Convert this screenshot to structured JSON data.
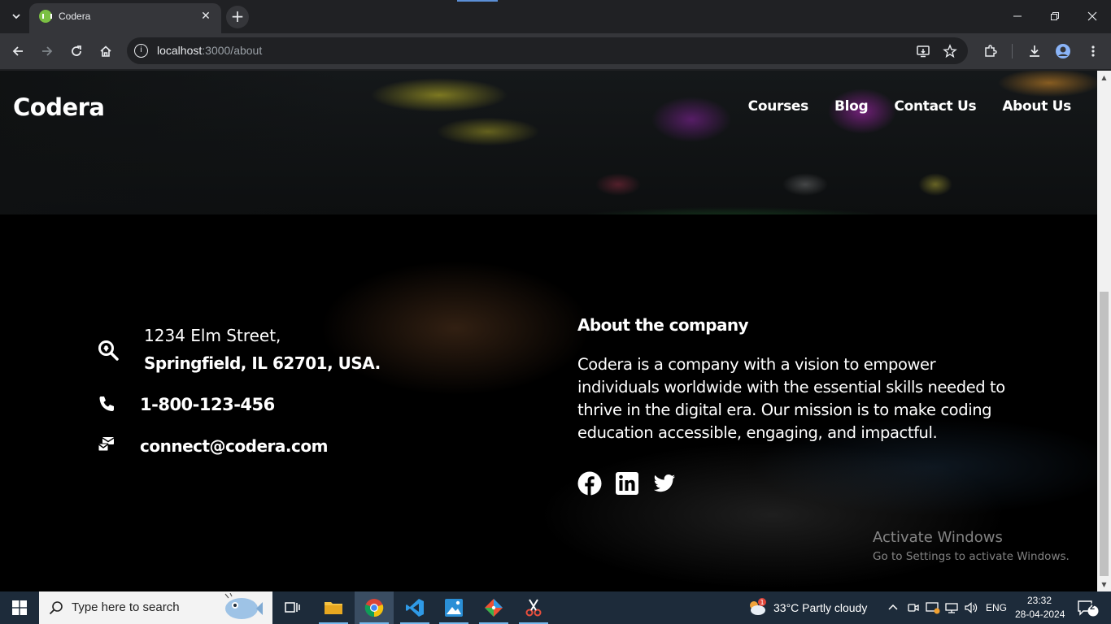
{
  "browser": {
    "tab_title": "Codera",
    "tab_close": "✕",
    "new_tab": "+",
    "url_host": "localhost",
    "url_path": ":3000/about"
  },
  "site": {
    "brand": "Codera",
    "nav": [
      "Courses",
      "Blog",
      "Contact Us",
      "About Us"
    ]
  },
  "contact": {
    "address_line1": "1234 Elm Street,",
    "address_line2": "Springfield, IL 62701, USA.",
    "phone": "1-800-123-456",
    "email": "connect@codera.com"
  },
  "about": {
    "title": "About the company",
    "body": "Codera is a company with a vision to empower individuals worldwide with the essential skills needed to thrive in the digital era. Our mission is to make coding education accessible, engaging, and impactful.",
    "socials": [
      "facebook-icon",
      "linkedin-icon",
      "twitter-icon"
    ]
  },
  "watermark": {
    "line1": "Activate Windows",
    "line2": "Go to Settings to activate Windows."
  },
  "taskbar": {
    "search_placeholder": "Type here to search",
    "weather": "33°C  Partly cloudy",
    "weather_badge": "1",
    "language": "ENG",
    "time": "23:32",
    "date": "28-04-2024",
    "notifications": "2"
  },
  "colors": {
    "chrome_dark": "#202124",
    "chrome_toolbar": "#35363a",
    "taskbar": "#1d2b3a",
    "accent_blue": "#76b9ed"
  }
}
